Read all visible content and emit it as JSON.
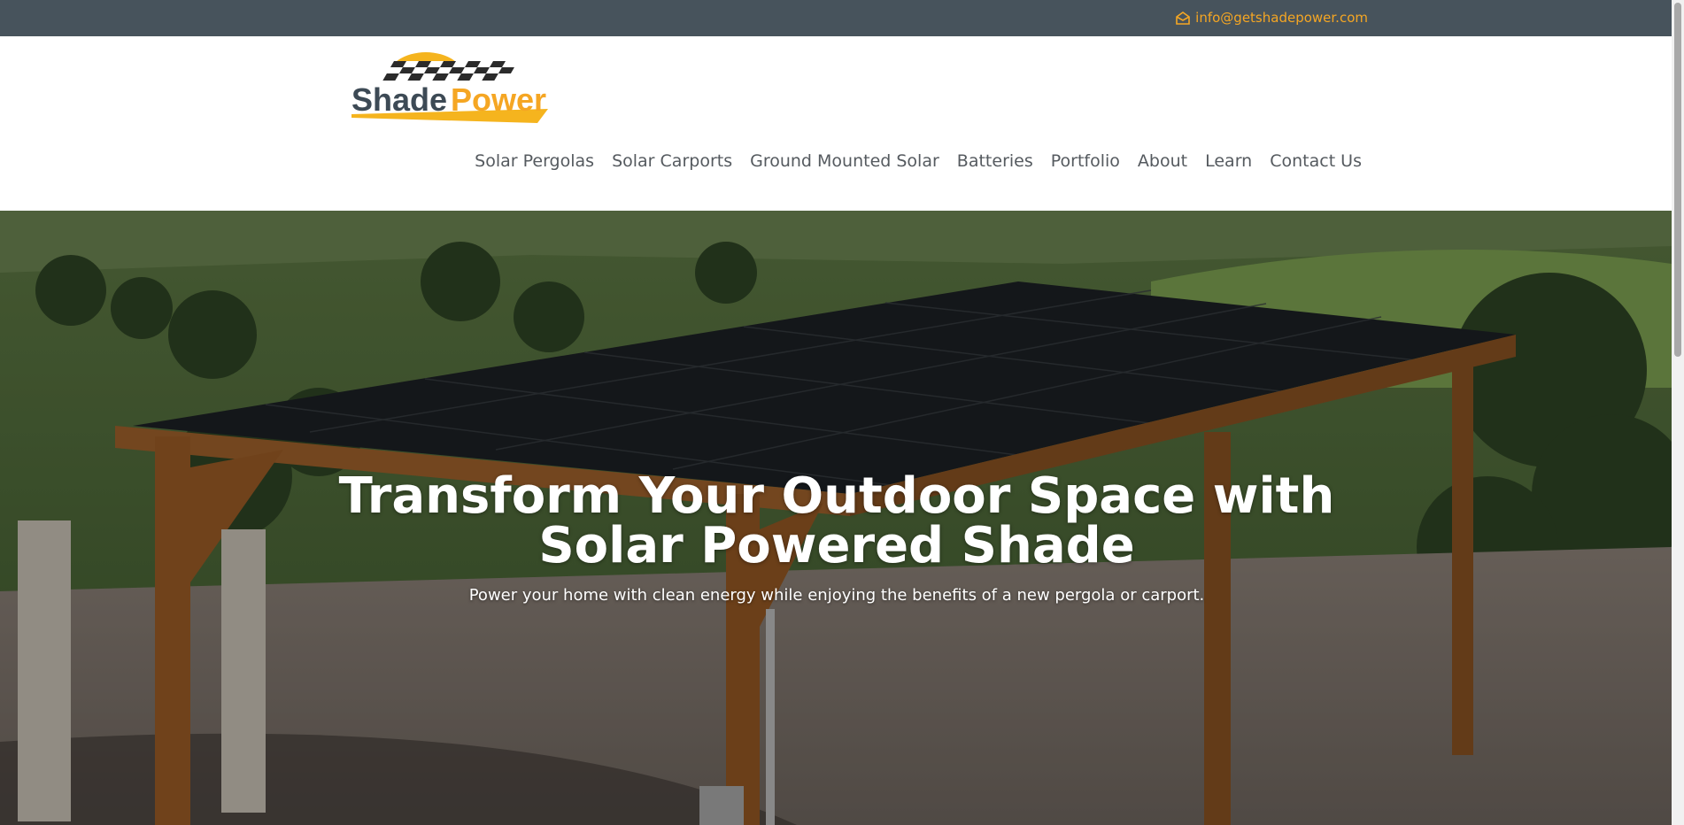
{
  "topbar": {
    "email": "info@getshadepower.com",
    "email_icon": "envelope-open-icon",
    "accent_color": "#f5a623",
    "background_color": "#47535c"
  },
  "header": {
    "logo": {
      "word1": "Shade",
      "word2": "Power",
      "word1_color": "#3d4a55",
      "word2_color": "#f5a623"
    },
    "nav": [
      {
        "label": "Solar Pergolas"
      },
      {
        "label": "Solar Carports"
      },
      {
        "label": "Ground Mounted Solar"
      },
      {
        "label": "Batteries"
      },
      {
        "label": "Portfolio"
      },
      {
        "label": "About"
      },
      {
        "label": "Learn"
      },
      {
        "label": "Contact Us"
      }
    ]
  },
  "hero": {
    "title": "Transform Your Outdoor Space with Solar Powered Shade",
    "subtitle": "Power your home with clean energy while enjoying the benefits of a new pergola or carport.",
    "background_description_icon": "solar-pergola-photo"
  }
}
